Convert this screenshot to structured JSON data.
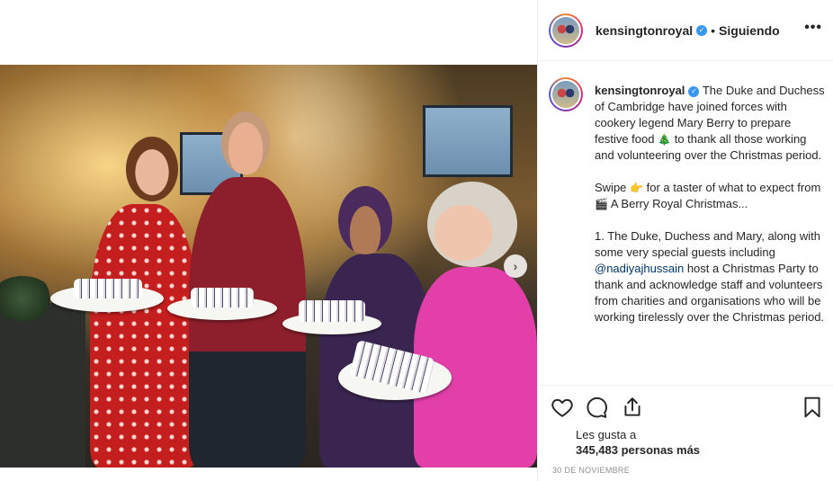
{
  "post": {
    "username": "kensingtonroyal",
    "follow_status": "Siguiendo",
    "separator": "•",
    "more_label": "•••"
  },
  "caption": {
    "username": "kensingtonroyal",
    "p1": "The Duke and Duchess of Cambridge have joined forces with cookery legend Mary Berry to prepare festive food",
    "p1_emoji": "🎄",
    "p1_end": "to thank all those working and volunteering over the Christmas period.",
    "p2_start": "Swipe",
    "p2_emoji1": "👉",
    "p2_mid": "for a taster of what to expect from",
    "p2_emoji2": "🎬",
    "p2_end": "A Berry Royal Christmas...",
    "p3_start": "1. The Duke, Duchess and Mary, along with some very special guests including",
    "p3_mention": "@nadiyajhussain",
    "p3_end": "host a Christmas Party to thank and acknowledge staff and volunteers from charities and organisations who will be working tirelessly over the Christmas period."
  },
  "likes": {
    "line1": "Les gusta a",
    "line2": "345,483 personas más"
  },
  "date": "30 DE NOVIEMBRE",
  "icons": {
    "like": "heart-icon",
    "comment": "comment-icon",
    "share": "share-icon",
    "save": "bookmark-icon",
    "next": "chevron-right-icon",
    "verified": "verified-badge-icon"
  },
  "colors": {
    "verified": "#3897f0",
    "mention": "#00376b",
    "text": "#262626",
    "muted": "#8e8e8e"
  }
}
